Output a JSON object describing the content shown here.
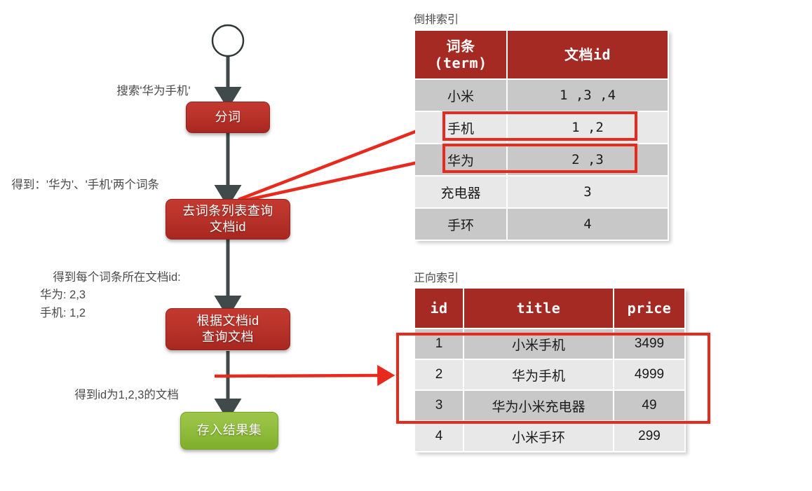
{
  "flow": {
    "start_node": "start-circle",
    "steps": [
      {
        "id": "fenci",
        "label": "分词",
        "color": "#bb342c"
      },
      {
        "id": "query-terms",
        "label": "去词条列表查询\n文档id",
        "color": "#bb342c"
      },
      {
        "id": "query-docs",
        "label": "根据文档id\n查询文档",
        "color": "#bb342c"
      },
      {
        "id": "result-set",
        "label": "存入结果集",
        "color": "#93bf3f"
      }
    ],
    "notes": [
      {
        "id": "note-search",
        "text": "搜索'华为手机'"
      },
      {
        "id": "note-terms",
        "text": "得到：'华为'、'手机'两个词条"
      },
      {
        "id": "note-docids",
        "text": "得到每个词条所在文档id:\n华为: 2,3\n手机: 1,2"
      },
      {
        "id": "note-docs",
        "text": "得到id为1,2,3的文档"
      }
    ]
  },
  "inverted_index": {
    "caption": "倒排索引",
    "headers": [
      "词条\n(term)",
      "文档id"
    ],
    "rows": [
      {
        "term": "小米",
        "doc_ids": "1 ,3 ,4",
        "highlight": false
      },
      {
        "term": "手机",
        "doc_ids": "1 ,2",
        "highlight": true
      },
      {
        "term": "华为",
        "doc_ids": "2 ,3",
        "highlight": true
      },
      {
        "term": "充电器",
        "doc_ids": "3",
        "highlight": false
      },
      {
        "term": "手环",
        "doc_ids": "4",
        "highlight": false
      }
    ]
  },
  "forward_index": {
    "caption": "正向索引",
    "headers": [
      "id",
      "title",
      "price"
    ],
    "rows": [
      {
        "id": "1",
        "title": "小米手机",
        "price": "3499",
        "highlight": true
      },
      {
        "id": "2",
        "title": "华为手机",
        "price": "4999",
        "highlight": true
      },
      {
        "id": "3",
        "title": "华为小米充电器",
        "price": "49",
        "highlight": true
      },
      {
        "id": "4",
        "title": "小米手环",
        "price": "299",
        "highlight": false
      }
    ]
  },
  "colors": {
    "header_red": "#a52a24",
    "node_red": "#bb342c",
    "node_green": "#93bf3f",
    "arrow_red": "#e8291e",
    "flow_arrow": "#404a4a",
    "row_dark": "#c8c8c8",
    "row_light": "#e8e8e8"
  }
}
